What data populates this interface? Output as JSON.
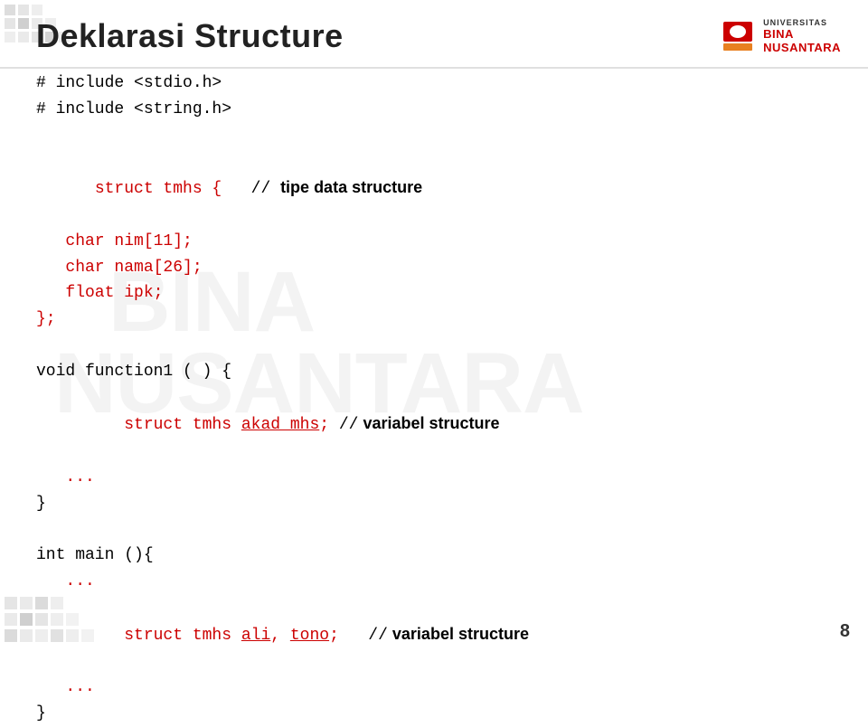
{
  "page": {
    "title": "Deklarasi Structure",
    "number": "8",
    "background_watermark_line1": "BINA",
    "background_watermark_line2": "NUSANTARA"
  },
  "logo": {
    "universitas_label": "UNIVERSITAS",
    "bina_label": "BINA",
    "nusantara_label": "NUSANTARA"
  },
  "code": {
    "line1_black": "# include <stdio.h>",
    "line2_black": "# include <string.h>",
    "line3_empty": "",
    "line4_red": "struct tmhs {",
    "line4_comment": "//",
    "line4_bold": " tipe data structure",
    "line5": "   char nim[11];",
    "line6": "   char nama[26];",
    "line7": "   float ipk;",
    "line8": "};",
    "line9_empty": "",
    "line10_black": "void function1 ( ) {",
    "line11_red": "   struct tmhs ",
    "line11_red_underline": "akad_mhs",
    "line11_black": "; //",
    "line11_bold": " variabel structure",
    "line12": "   ...",
    "line13": "}",
    "line14_empty": "",
    "line15_black": "int main (){",
    "line16": "   ...",
    "line17_red": "   struct tmhs ",
    "line17_red_parts": [
      "ali",
      ", ",
      "tono"
    ],
    "line17_black": ";   //",
    "line17_bold": " variabel structure",
    "line18": "   ...",
    "line19": "}"
  }
}
